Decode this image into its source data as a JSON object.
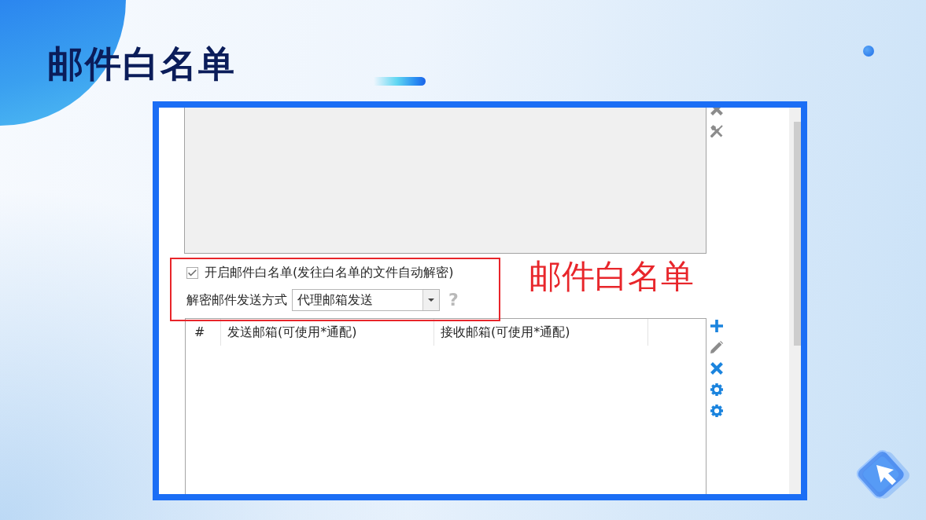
{
  "slide": {
    "title": "邮件白名单",
    "annotation": "邮件白名单"
  },
  "panel_tools": [
    {
      "kind": "delete",
      "disabled": true
    },
    {
      "kind": "tools",
      "disabled": true
    }
  ],
  "whitelist": {
    "label": "开启邮件白名单(发往白名单的文件自动解密)",
    "checked": true
  },
  "send_mode": {
    "label": "解密邮件发送方式",
    "value": "代理邮箱发送",
    "help": "?"
  },
  "table": {
    "columns": [
      "#",
      "发送邮箱(可使用*通配)",
      "接收邮箱(可使用*通配)"
    ]
  },
  "table_tools": [
    {
      "kind": "add",
      "disabled": false
    },
    {
      "kind": "edit",
      "disabled": true
    },
    {
      "kind": "delete",
      "disabled": false
    },
    {
      "kind": "settings",
      "disabled": false
    },
    {
      "kind": "settings",
      "disabled": false
    }
  ]
}
